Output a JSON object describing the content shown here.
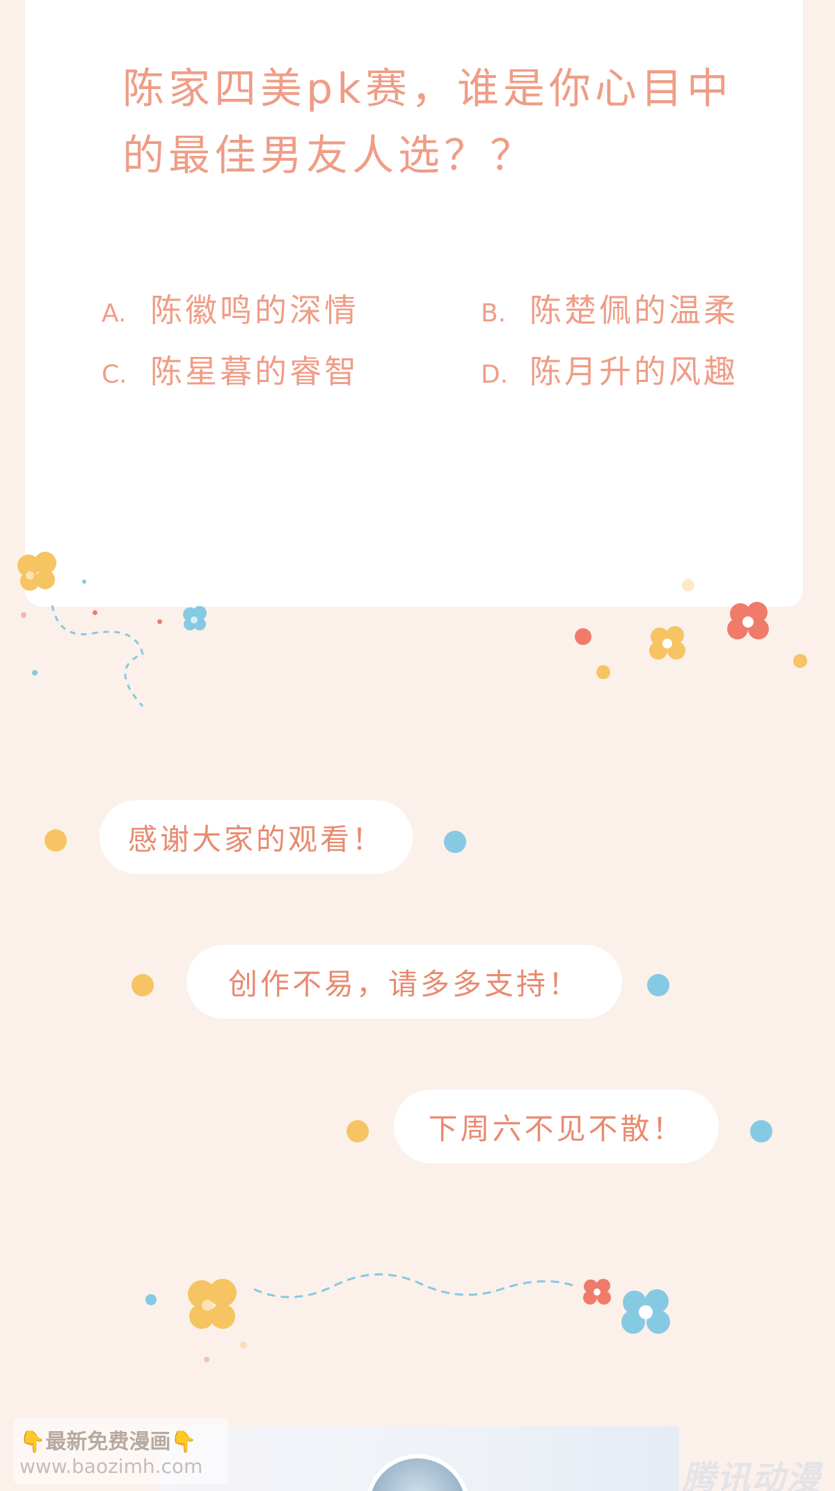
{
  "card": {
    "question": "陈家四美pk赛，谁是你心目中的最佳男友人选？？",
    "options": [
      {
        "letter": "A.",
        "text": "陈徽鸣的深情"
      },
      {
        "letter": "B.",
        "text": "陈楚佩的温柔"
      },
      {
        "letter": "C.",
        "text": "陈星暮的睿智"
      },
      {
        "letter": "D.",
        "text": "陈月升的风趣"
      }
    ]
  },
  "messages": [
    "感谢大家的观看！",
    "创作不易，请多多支持！",
    "下周六不见不散！"
  ],
  "footer": {
    "promo_line1": "👇最新免费漫画👇",
    "promo_line2": "www.baozimh.com",
    "watermark": "腾讯动漫"
  },
  "colors": {
    "background": "#fbf0ea",
    "text_accent": "#ef9d86",
    "dot_yellow": "#f6c462",
    "dot_blue": "#86c9e2",
    "flower_red": "#f07b6a"
  }
}
